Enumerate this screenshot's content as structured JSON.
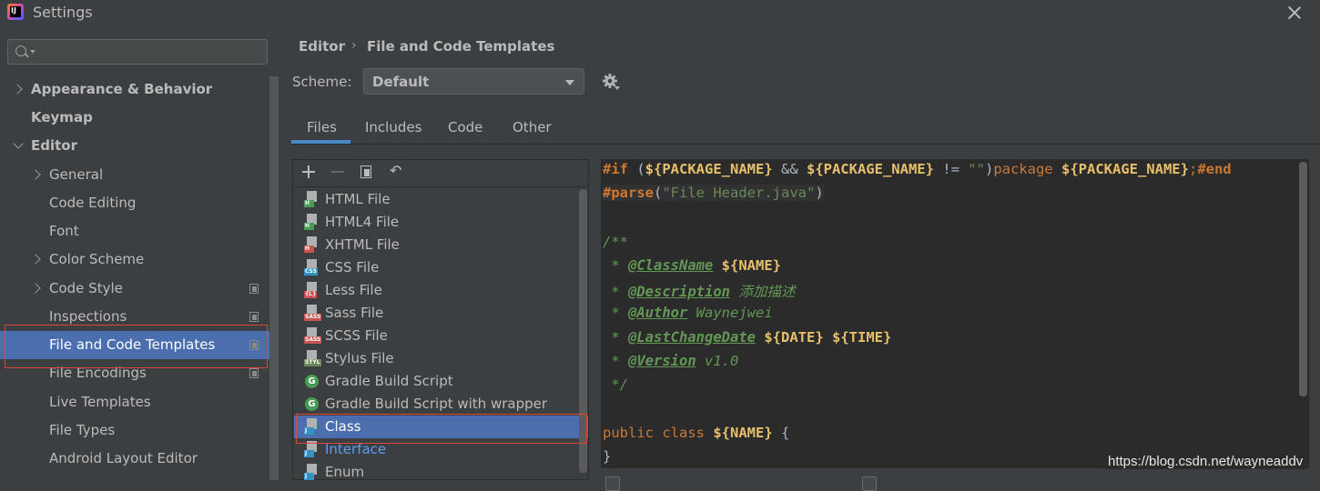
{
  "window": {
    "title": "Settings"
  },
  "search": {
    "placeholder": ""
  },
  "sidebar": {
    "items": [
      {
        "label": "Appearance & Behavior",
        "expander": "collapsed"
      },
      {
        "label": "Keymap"
      },
      {
        "label": "Editor",
        "expander": "expanded"
      },
      {
        "label": "General",
        "expander": "collapsed"
      },
      {
        "label": "Code Editing"
      },
      {
        "label": "Font"
      },
      {
        "label": "Color Scheme",
        "expander": "collapsed"
      },
      {
        "label": "Code Style",
        "expander": "collapsed",
        "project_icon": "copy-icon"
      },
      {
        "label": "Inspections",
        "project_icon": "copy-icon"
      },
      {
        "label": "File and Code Templates",
        "selected": true,
        "project_icon": "copy-icon"
      },
      {
        "label": "File Encodings",
        "project_icon": "copy-icon"
      },
      {
        "label": "Live Templates"
      },
      {
        "label": "File Types"
      },
      {
        "label": "Android Layout Editor"
      }
    ]
  },
  "breadcrumb": {
    "root": "Editor",
    "separator": "›",
    "current": "File and Code Templates"
  },
  "scheme": {
    "label": "Scheme:",
    "value": "Default"
  },
  "tabs": [
    {
      "label": "Files",
      "active": true
    },
    {
      "label": "Includes"
    },
    {
      "label": "Code"
    },
    {
      "label": "Other"
    }
  ],
  "toolbar": {
    "undo_glyph": "↶"
  },
  "templates": [
    {
      "label": "HTML File",
      "tag": "H",
      "tag_color": "#499c54"
    },
    {
      "label": "HTML4 File",
      "tag": "H",
      "tag_color": "#499c54"
    },
    {
      "label": "XHTML File",
      "tag": "H",
      "tag_color": "#c75450"
    },
    {
      "label": "CSS File",
      "tag": "CSS",
      "tag_color": "#3592c4"
    },
    {
      "label": "Less File",
      "tag": "{L}",
      "tag_color": "#c75450"
    },
    {
      "label": "Sass File",
      "tag": "SASS",
      "tag_color": "#c75450"
    },
    {
      "label": "SCSS File",
      "tag": "SASS",
      "tag_color": "#c75450"
    },
    {
      "label": "Stylus File",
      "tag": "STYL",
      "tag_color": "#6a8759"
    },
    {
      "label": "Gradle Build Script",
      "icon": "G",
      "tag_color": "#499c54"
    },
    {
      "label": "Gradle Build Script with wrapper",
      "icon": "G",
      "tag_color": "#499c54"
    },
    {
      "label": "Class",
      "tag": "J",
      "tag_color": "#3592c4",
      "selected": true
    },
    {
      "label": "Interface",
      "tag": "J",
      "tag_color": "#3592c4",
      "link": true
    },
    {
      "label": "Enum",
      "tag": "J",
      "tag_color": "#3592c4"
    }
  ],
  "editor": {
    "l1": {
      "a": "#if",
      "b": " (",
      "c": "${PACKAGE_NAME}",
      "d": " && ",
      "e": "${PACKAGE_NAME}",
      "f": " != ",
      "g": "\"\"",
      "h": ")",
      "i": "package",
      "j": " ",
      "k": "${PACKAGE_NAME}",
      "l": ";",
      "m": "#end"
    },
    "l2": {
      "a": "#parse",
      "b": "(",
      "c": "\"File Header.java\"",
      "d": ")"
    },
    "l3": {
      "a": "/**"
    },
    "l4": {
      "a": " * ",
      "b": "@ClassName",
      "c": " ",
      "d": "${NAME}"
    },
    "l5": {
      "a": " * ",
      "b": "@Description",
      "c": " 添加描述"
    },
    "l6": {
      "a": " * ",
      "b": "@Author",
      "c": " Waynejwei"
    },
    "l7": {
      "a": " * ",
      "b": "@LastChangeDate",
      "c": " ",
      "d": "${DATE}",
      "e": " ",
      "f": "${TIME}"
    },
    "l8": {
      "a": " * ",
      "b": "@Version",
      "c": " v1.0"
    },
    "l9": {
      "a": " */"
    },
    "l10": {
      "a": "public class",
      "b": " ",
      "c": "${NAME}",
      "d": " {"
    },
    "l11": {
      "a": "}"
    }
  },
  "watermark": "https://blog.csdn.net/wayneaddv",
  "colors": {
    "selection": "#4b6eaf",
    "highlight_box": "#e0443e",
    "tab_underline": "#4a88c7"
  }
}
